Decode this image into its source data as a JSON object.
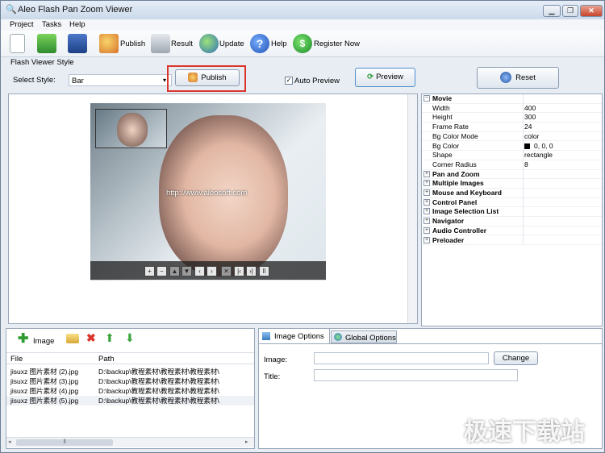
{
  "window": {
    "title": "Aleo Flash Pan Zoom Viewer",
    "min": "▁",
    "max": "❐",
    "close": "✕"
  },
  "menu": [
    "Project",
    "Tasks",
    "Help"
  ],
  "toolbar": {
    "publish": "Publish",
    "result": "Result",
    "update": "Update",
    "help": "Help",
    "register": "Register Now"
  },
  "style_section": {
    "group_title": "Flash Viewer Style",
    "select_label": "Select Style:",
    "select_value": "Bar",
    "publish_label": "Publish",
    "auto_preview": "Auto Preview",
    "auto_preview_checked": true,
    "preview_label": "Preview",
    "reset_label": "Reset"
  },
  "preview": {
    "url_text": "http://www.aleosoft.com",
    "nav_icons": [
      "zoom-in",
      "zoom-out",
      "pan-up",
      "pan-down",
      "pan-left",
      "pan-right",
      "close",
      "first",
      "last",
      "pause"
    ]
  },
  "properties": {
    "movie_header": "Movie",
    "movie": [
      {
        "k": "Width",
        "v": "400"
      },
      {
        "k": "Height",
        "v": "300"
      },
      {
        "k": "Frame Rate",
        "v": "24"
      },
      {
        "k": "Bg Color Mode",
        "v": "color"
      },
      {
        "k": "Bg Color",
        "v": "0, 0, 0"
      },
      {
        "k": "Shape",
        "v": "rectangle"
      },
      {
        "k": "Corner Radius",
        "v": "8"
      }
    ],
    "groups": [
      "Pan and Zoom",
      "Multiple Images",
      "Mouse and Keyboard",
      "Control Panel",
      "Image Selection List",
      "Navigator",
      "Audio Controller",
      "Preloader"
    ]
  },
  "image_list": {
    "add_label": "Image",
    "columns": [
      "File",
      "Path"
    ],
    "rows": [
      {
        "file": "jisuxz 图片素材 (2).jpg",
        "path": "D:\\backup\\教程素材\\教程素材\\教程素材\\"
      },
      {
        "file": "jisuxz 图片素材 (3).jpg",
        "path": "D:\\backup\\教程素材\\教程素材\\教程素材\\"
      },
      {
        "file": "jisuxz 图片素材 (4).jpg",
        "path": "D:\\backup\\教程素材\\教程素材\\教程素材\\"
      },
      {
        "file": "jisuxz 图片素材 (5).jpg",
        "path": "D:\\backup\\教程素材\\教程素材\\教程素材\\"
      }
    ],
    "scroll_grip": "⦀"
  },
  "options": {
    "tab_image": "Image Options",
    "tab_global": "Global Options",
    "image_label": "Image:",
    "title_label": "Title:",
    "change_label": "Change"
  },
  "watermark": "极速下载站"
}
